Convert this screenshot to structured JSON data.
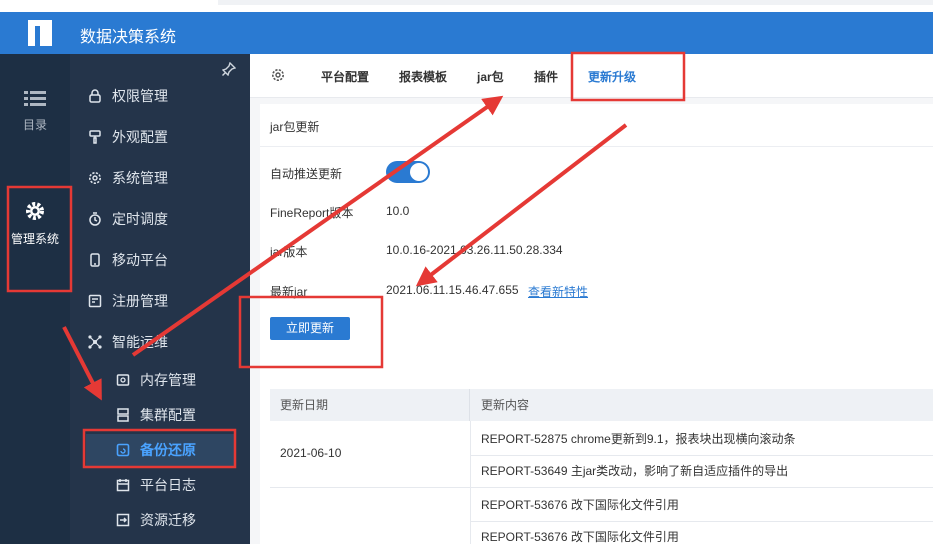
{
  "header": {
    "title": "数据决策系统"
  },
  "rail": {
    "items": [
      {
        "label": "目录"
      },
      {
        "label": "管理系统"
      }
    ]
  },
  "menu": {
    "items": [
      {
        "label": "权限管理"
      },
      {
        "label": "外观配置"
      },
      {
        "label": "系统管理"
      },
      {
        "label": "定时调度"
      },
      {
        "label": "移动平台"
      },
      {
        "label": "注册管理"
      },
      {
        "label": "智能运维"
      }
    ],
    "sub_items": [
      {
        "label": "内存管理"
      },
      {
        "label": "集群配置"
      },
      {
        "label": "备份还原"
      },
      {
        "label": "平台日志"
      },
      {
        "label": "资源迁移"
      }
    ]
  },
  "tabs": [
    {
      "label": "平台配置"
    },
    {
      "label": "报表模板"
    },
    {
      "label": "jar包"
    },
    {
      "label": "插件"
    },
    {
      "label": "更新升级"
    }
  ],
  "panel": {
    "section_title": "jar包更新",
    "auto_push_label": "自动推送更新",
    "auto_push_on": true,
    "finereport_label": "FineReport版本",
    "finereport_value": "10.0",
    "jar_label": "jar版本",
    "jar_value": "10.0.16-2021.03.26.11.50.28.334",
    "latest_label": "最新jar",
    "latest_value": "2021.06.11.15.46.47.655",
    "features_link": "查看新特性",
    "update_button": "立即更新"
  },
  "table": {
    "headers": [
      "更新日期",
      "更新内容"
    ],
    "date": "2021-06-10",
    "rows": [
      "REPORT-52875 chrome更新到9.1，报表块出现横向滚动条",
      "REPORT-53649 主jar类改动，影响了新自适应插件的导出",
      "REPORT-53676 改下国际化文件引用",
      "REPORT-53676 改下国际化文件引用"
    ]
  },
  "colors": {
    "accent": "#2a7ad2",
    "annotation": "#e53935",
    "sidebar": "#24344a"
  }
}
